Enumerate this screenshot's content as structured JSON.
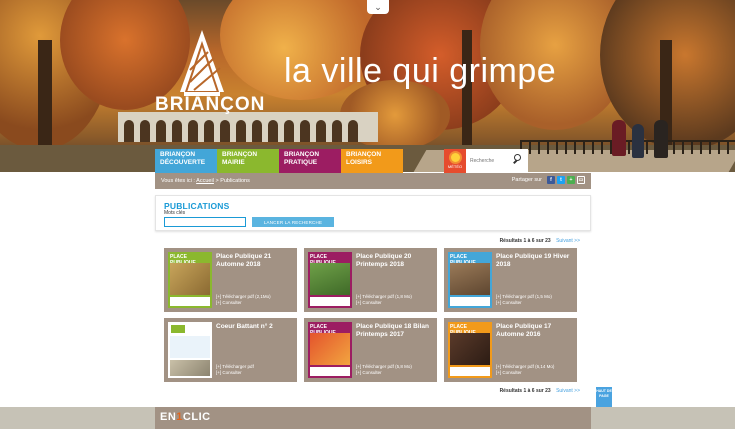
{
  "header": {
    "brand": "BRIANÇON",
    "tagline": "la ville qui grimpe",
    "top_toggle_icon": "chevron-down-icon"
  },
  "nav": {
    "items": [
      {
        "label": "BRIANÇON DÉCOUVERTE",
        "color": "#43a6d8"
      },
      {
        "label": "BRIANÇON MAIRIE",
        "color": "#8bb82e"
      },
      {
        "label": "BRIANÇON PRATIQUE",
        "color": "#9c1d62"
      },
      {
        "label": "BRIANÇON LOISIRS",
        "color": "#f29a1a"
      }
    ],
    "meteo_label": "MÉTÉO",
    "meteo_icon": "sun-icon",
    "search_placeholder": "Recherche",
    "search_icon": "search-icon"
  },
  "breadcrumb": {
    "prefix": "Vous êtes ici :",
    "home": "Accueil",
    "separator": ">",
    "current": "Publications"
  },
  "share": {
    "label": "Partager sur",
    "icons": [
      "facebook-icon",
      "twitter-icon",
      "share-icon",
      "print-icon"
    ]
  },
  "search_panel": {
    "title": "PUBLICATIONS",
    "field_label": "Mots clés",
    "button_label": "LANCER LA RECHERCHE"
  },
  "results": {
    "summary": "Résultats 1 à 6 sur 23",
    "next": "Suivant >>"
  },
  "publications": [
    {
      "title": "Place Publique 21 Automne 2018",
      "download": "[+] Télécharger pdf (2,1Mo)",
      "consult": "[+] Consulter",
      "cover_color": "#8bb82e"
    },
    {
      "title": "Place Publique 20 Printemps 2018",
      "download": "[+] Télécharger pdf (1,8 Mo)",
      "consult": "[+] Consulter",
      "cover_color": "#9c1d62"
    },
    {
      "title": "Place Publique 19 Hiver 2018",
      "download": "[+] Télécharger pdf (1,5 Mo)",
      "consult": "[+] Consulter",
      "cover_color": "#43a6d8"
    },
    {
      "title": "Coeur Battant n° 2",
      "download": "[+] Télécharger pdf",
      "consult": "[+] Consulter",
      "cover_color": "#ffffff"
    },
    {
      "title": "Place Publique 18 Bilan Printemps 2017",
      "download": "[+] Télécharger pdf (5,8 Mo)",
      "consult": "[+] Consulter",
      "cover_color": "#9c1d62"
    },
    {
      "title": "Place Publique 17 Automne 2016",
      "download": "[+] Télécharger pdf (6,14 Mo)",
      "consult": "[+] Consulter",
      "cover_color": "#f29a1a"
    }
  ],
  "cover_header": "PLACE PUBLIQUE",
  "back_to_top": "HAUT DE PAGE",
  "footer": {
    "brand_a": "EN",
    "brand_b": "1",
    "brand_c": "CLIC"
  }
}
